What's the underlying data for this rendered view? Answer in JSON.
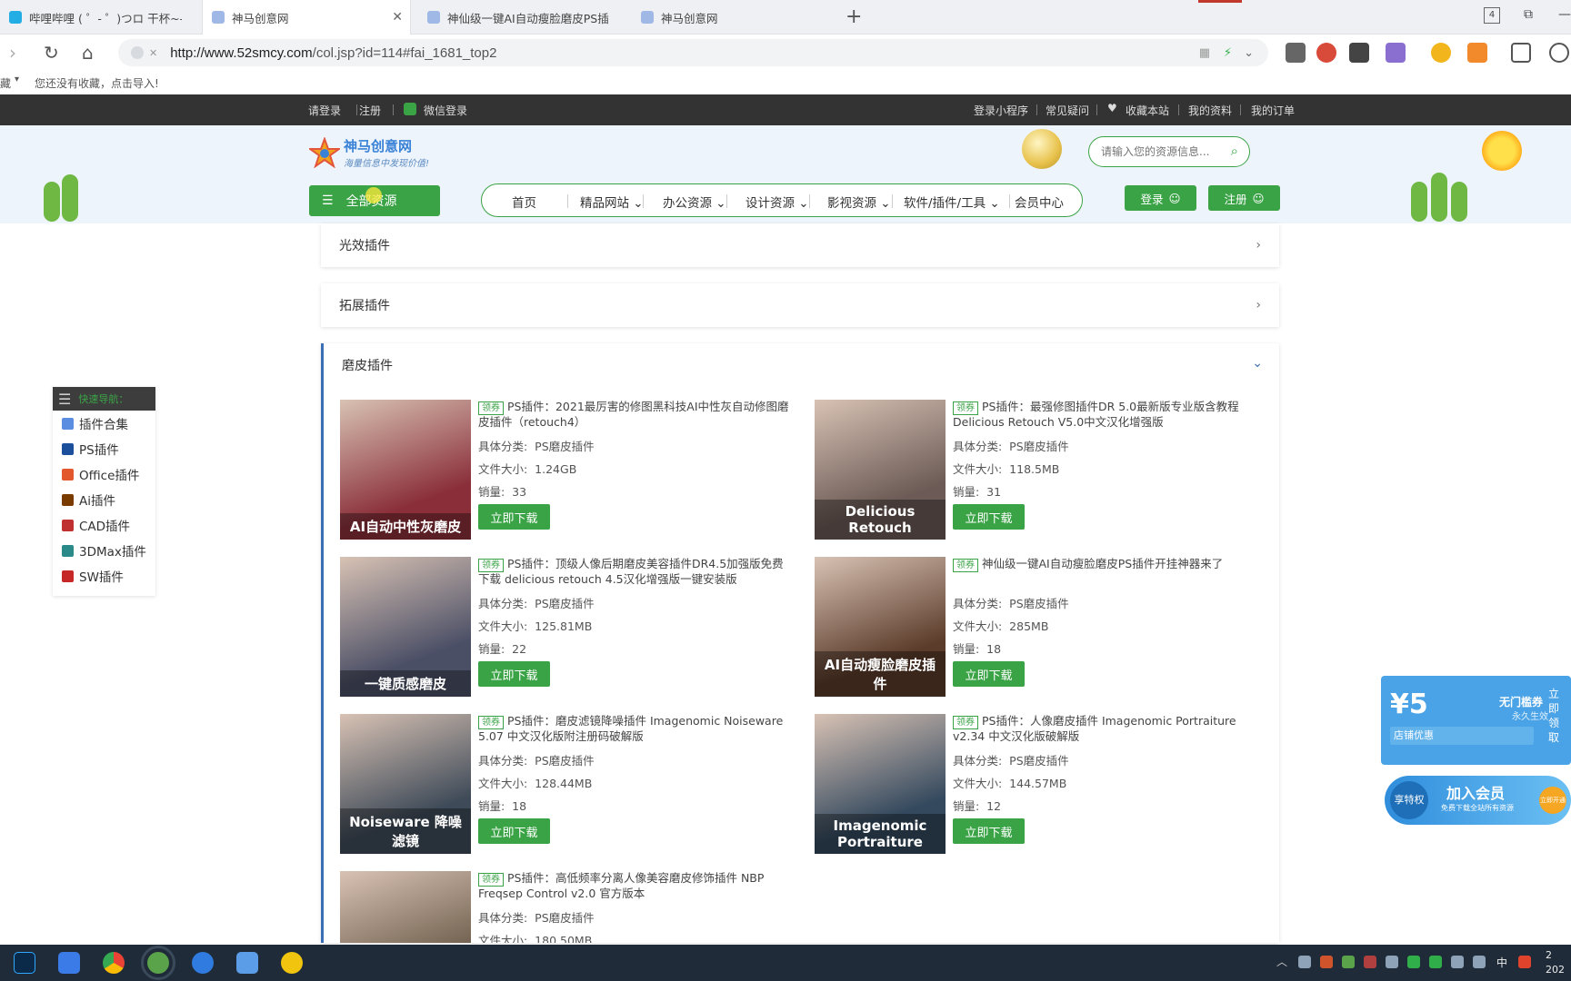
{
  "browser": {
    "tabs": [
      {
        "title": "哔哩哔哩 ( ゜- ゜)つロ 干杯~-bili"
      },
      {
        "title": "神马创意网"
      },
      {
        "title": "神仙级一键AI自动瘦脸磨皮PS插"
      },
      {
        "title": "神马创意网"
      }
    ],
    "tab_counter": "4",
    "url_host": "http://www.52smcy.com",
    "url_path": "/col.jsp?id=114#fai_1681_top2",
    "bookmarks_text": "您还没有收藏，点击导入!",
    "bookmarks_prefix": "藏"
  },
  "site_top": {
    "left": [
      "请登录",
      "注册",
      "微信登录"
    ],
    "right": [
      "登录小程序",
      "常见疑问",
      "收藏本站",
      "我的资料",
      "我的订单"
    ]
  },
  "header": {
    "logo_title": "神马创意网",
    "logo_slogan": "海量信息中发现价值!",
    "search_placeholder": "请输入您的资源信息...",
    "all_resources": "全部资源",
    "nav": [
      "首页",
      "精品网站",
      "办公资源",
      "设计资源",
      "影视资源",
      "软件/插件/工具",
      "会员中心"
    ],
    "login": "登录",
    "register": "注册"
  },
  "sections": {
    "collapsed": [
      "光效插件",
      "拓展插件"
    ],
    "open_title": "磨皮插件"
  },
  "labels": {
    "badge": "领券",
    "category": "具体分类:",
    "size": "文件大小:",
    "sales": "销量:",
    "download": "立即下载"
  },
  "products": [
    {
      "title": "PS插件：2021最厉害的修图黑科技AI中性灰自动修图磨皮插件（retouch4）",
      "category": "PS磨皮插件",
      "size": "1.24GB",
      "sales": "33",
      "thumb_caption": "AI自动中性灰磨皮",
      "thumb_color": "#8a2f3a"
    },
    {
      "title": "PS插件：最强修图插件DR 5.0最新版专业版含教程Delicious Retouch V5.0中文汉化增强版",
      "category": "PS磨皮插件",
      "size": "118.5MB",
      "sales": "31",
      "thumb_caption": "Delicious Retouch",
      "thumb_color": "#6b5a55"
    },
    {
      "title": "PS插件：顶级人像后期磨皮美容插件DR4.5加强版免费下载 delicious retouch 4.5汉化增强版一键安装版",
      "category": "PS磨皮插件",
      "size": "125.81MB",
      "sales": "22",
      "thumb_caption": "一键质感磨皮",
      "thumb_color": "#4b4f66"
    },
    {
      "title": "神仙级一键AI自动瘦脸磨皮PS插件开挂神器来了",
      "category": "PS磨皮插件",
      "size": "285MB",
      "sales": "18",
      "thumb_caption": "AI自动瘦脸磨皮插件",
      "thumb_color": "#5b3b2a"
    },
    {
      "title": "PS插件：磨皮滤镜降噪插件 Imagenomic Noiseware 5.07 中文汉化版附注册码破解版",
      "category": "PS磨皮插件",
      "size": "128.44MB",
      "sales": "18",
      "thumb_caption": "Noiseware 降噪滤镜",
      "thumb_color": "#3e4a58"
    },
    {
      "title": "PS插件：人像磨皮插件 Imagenomic Portraiture v2.34 中文汉化版破解版",
      "category": "PS磨皮插件",
      "size": "144.57MB",
      "sales": "12",
      "thumb_caption": "Imagenomic Portraiture",
      "thumb_color": "#34495e"
    },
    {
      "title": "PS插件：高低频率分离人像美容磨皮修饰插件 NBP Freqsep Control v2.0 官方版本",
      "category": "PS磨皮插件",
      "size": "180.50MB",
      "sales": "",
      "thumb_caption": "",
      "thumb_color": "#6a5a48"
    }
  ],
  "quick_nav": {
    "title": "快速导航：",
    "items": [
      {
        "label": "插件合集",
        "color": "#5b8de0"
      },
      {
        "label": "PS插件",
        "color": "#1b4f9c"
      },
      {
        "label": "Office插件",
        "color": "#e2572b"
      },
      {
        "label": "Ai插件",
        "color": "#7a3b00"
      },
      {
        "label": "CAD插件",
        "color": "#c03030"
      },
      {
        "label": "3DMax插件",
        "color": "#2a8a8a"
      },
      {
        "label": "SW插件",
        "color": "#c62828"
      }
    ]
  },
  "floating": {
    "coupon_amount": "¥5",
    "coupon_title": "无门槛券",
    "coupon_sub": "永久生效",
    "coupon_label": "店铺优惠",
    "coupon_claim": "立即领取",
    "member_title": "加入会员",
    "member_sub": "免费下载全站所有资源",
    "member_badge": "享特权",
    "member_open": "立即开通"
  },
  "taskbar": {
    "ime": "中",
    "clock_top": "2",
    "clock_bottom": "202"
  },
  "colors": {
    "brand_green": "#3aa346",
    "accent_blue": "#3a6fb5",
    "topbar": "#333333"
  }
}
